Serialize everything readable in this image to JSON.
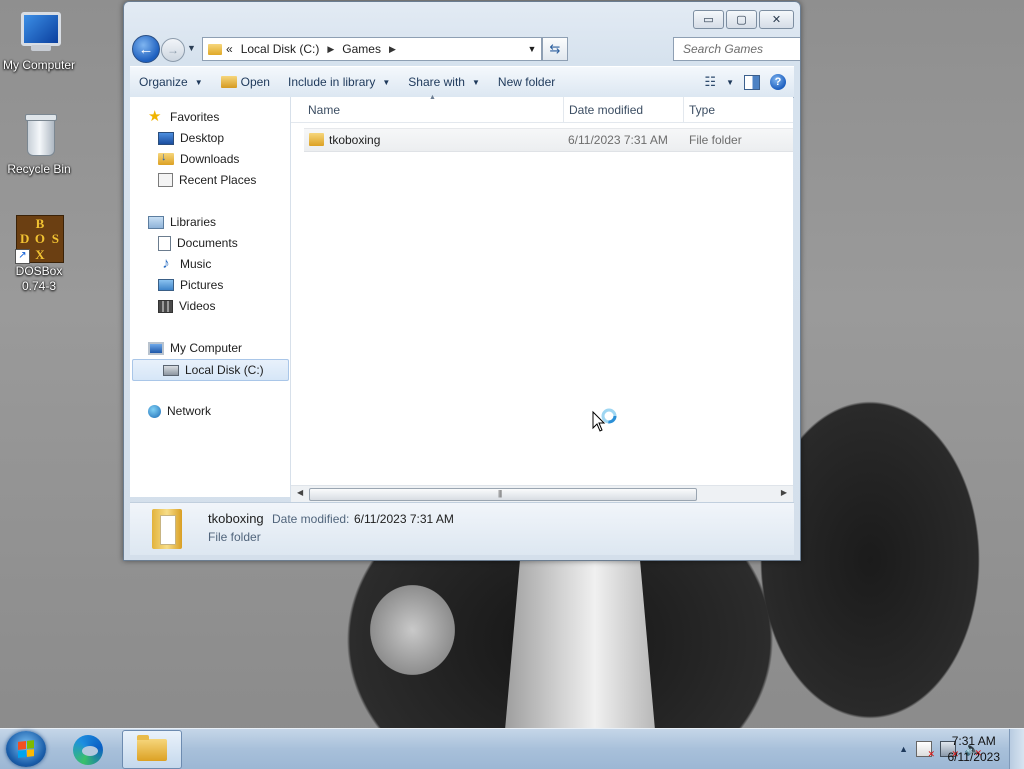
{
  "desktop": {
    "icons": [
      {
        "label": "My Computer",
        "icon": "my-computer-icon"
      },
      {
        "label": "Recycle Bin",
        "icon": "recycle-bin-icon"
      },
      {
        "label": "DOSBox 0.74-3",
        "icon": "dosbox-icon",
        "logo_letters": [
          "B",
          "D",
          "O",
          "S",
          "X"
        ]
      }
    ]
  },
  "window": {
    "caption_buttons": {
      "minimize": "▭",
      "maximize": "▢",
      "close": "✕"
    },
    "address": {
      "overflow": "«",
      "crumbs": [
        "Local Disk (C:)",
        "Games"
      ]
    },
    "search": {
      "placeholder": "Search Games"
    },
    "toolbar": {
      "organize": "Organize",
      "open": "Open",
      "include_in_library": "Include in library",
      "share_with": "Share with",
      "new_folder": "New folder"
    },
    "nav_pane": {
      "favorites": {
        "label": "Favorites",
        "items": [
          "Desktop",
          "Downloads",
          "Recent Places"
        ]
      },
      "libraries": {
        "label": "Libraries",
        "items": [
          "Documents",
          "Music",
          "Pictures",
          "Videos"
        ]
      },
      "computer": {
        "label": "My Computer",
        "items": [
          "Local Disk (C:)"
        ]
      },
      "network": {
        "label": "Network"
      }
    },
    "columns": {
      "name": "Name",
      "date_modified": "Date modified",
      "type": "Type"
    },
    "files": [
      {
        "name": "tkoboxing",
        "date_modified": "6/11/2023 7:31 AM",
        "type": "File folder"
      }
    ],
    "details": {
      "name": "tkoboxing",
      "date_modified_label": "Date modified:",
      "date_modified_value": "6/11/2023 7:31 AM",
      "type": "File folder"
    }
  },
  "taskbar": {
    "clock_time": "7:31 AM",
    "clock_date": "6/11/2023",
    "tray_up_arrow": "▲",
    "start_flag_colors": [
      "#f25022",
      "#7fba00",
      "#00a4ef",
      "#ffb900"
    ]
  }
}
